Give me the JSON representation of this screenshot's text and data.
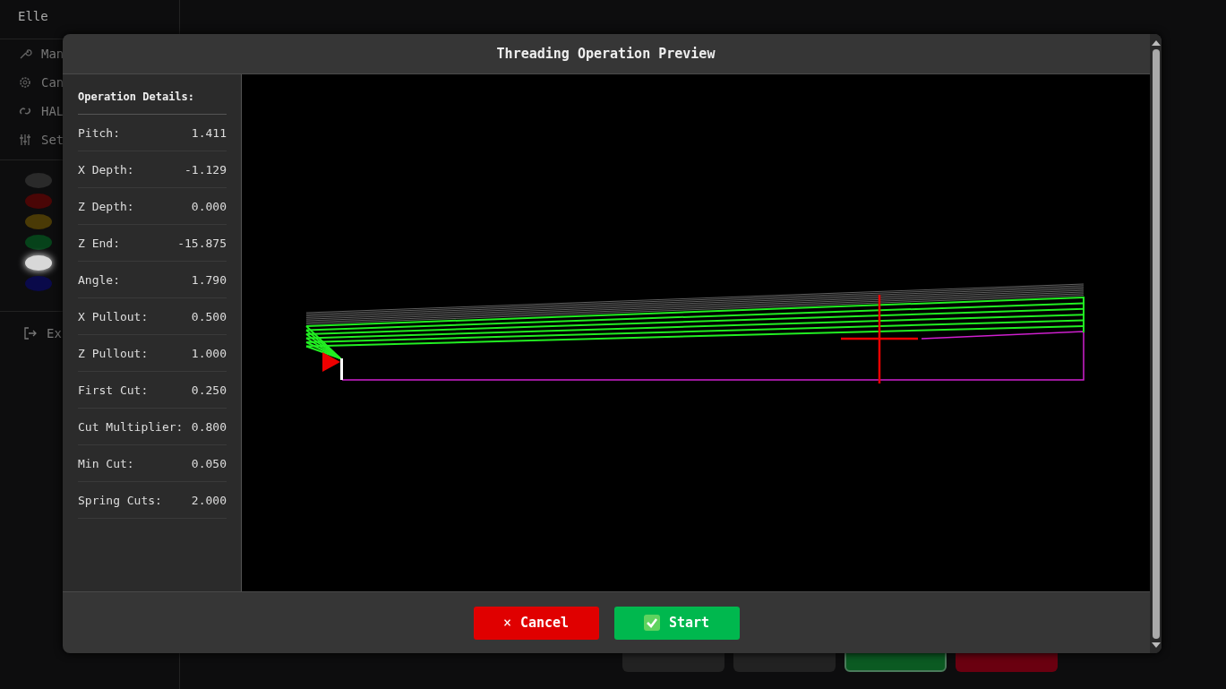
{
  "app": {
    "title": "Elle",
    "menu": [
      {
        "label": "Man"
      },
      {
        "label": "Can"
      },
      {
        "label": "HAL"
      },
      {
        "label": "Set"
      }
    ],
    "lamps": [
      {
        "color": "#2a2a2a",
        "on": false
      },
      {
        "color": "#4a0606",
        "on": false
      },
      {
        "color": "#4a3a06",
        "on": false
      },
      {
        "color": "#06421a",
        "on": false
      },
      {
        "color": "#d8d8d8",
        "on": true
      },
      {
        "color": "#0a0a4a",
        "on": false
      }
    ],
    "exit": "Ex",
    "bottom_buttons": [
      {
        "kind": "neutral"
      },
      {
        "kind": "neutral"
      },
      {
        "kind": "success"
      },
      {
        "kind": "danger"
      }
    ]
  },
  "dialog": {
    "title": "Threading Operation Preview",
    "details_title": "Operation Details:",
    "details": [
      {
        "label": "Pitch:",
        "value": "1.411"
      },
      {
        "label": "X Depth:",
        "value": "-1.129"
      },
      {
        "label": "Z Depth:",
        "value": "0.000"
      },
      {
        "label": "Z End:",
        "value": "-15.875"
      },
      {
        "label": "Angle:",
        "value": "1.790"
      },
      {
        "label": "X Pullout:",
        "value": "0.500"
      },
      {
        "label": "Z Pullout:",
        "value": "1.000"
      },
      {
        "label": "First Cut:",
        "value": "0.250"
      },
      {
        "label": "Cut Multiplier:",
        "value": "0.800"
      },
      {
        "label": "Min Cut:",
        "value": "0.050"
      },
      {
        "label": "Spring Cuts:",
        "value": "2.000"
      }
    ],
    "buttons": [
      {
        "label": "Cancel",
        "icon": "×",
        "kind": "cancel"
      },
      {
        "label": "Start",
        "kind": "confirm"
      }
    ]
  }
}
